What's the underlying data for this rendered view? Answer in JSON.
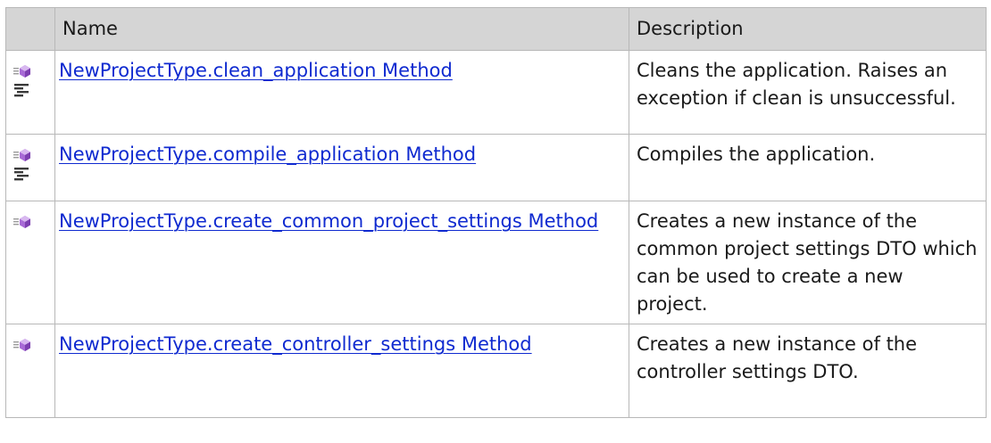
{
  "table": {
    "headers": {
      "icon": "",
      "name": "Name",
      "description": "Description"
    },
    "rows": [
      {
        "name": "NewProjectType.clean_application Method",
        "description": "Cleans the application. Raises an exception if clean is unsuccessful.",
        "icons": [
          "public-method-icon",
          "static-member-icon"
        ]
      },
      {
        "name": "NewProjectType.compile_application Method",
        "description": "Compiles the application.",
        "icons": [
          "public-method-icon",
          "static-member-icon"
        ]
      },
      {
        "name": "NewProjectType.create_common_project_settings Method",
        "description": "Creates a new instance of the common project settings DTO which can be used to create a new project.",
        "icons": [
          "public-method-icon"
        ]
      },
      {
        "name": "NewProjectType.create_controller_settings Method",
        "description": "Creates a new instance of the controller settings DTO.",
        "icons": [
          "public-method-icon"
        ]
      }
    ]
  },
  "colors": {
    "header_background": "#d5d5d5",
    "link": "#0f2ad0",
    "border": "#b8b8b8",
    "method_icon": "#a86ad6"
  }
}
